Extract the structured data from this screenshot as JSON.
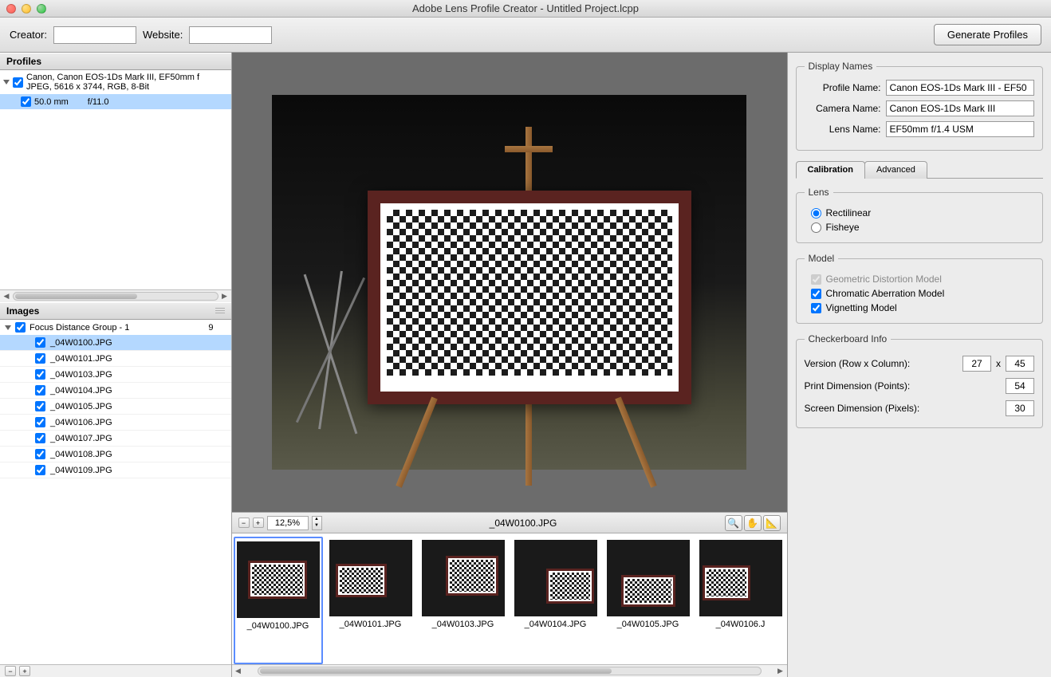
{
  "window": {
    "title": "Adobe Lens Profile Creator - Untitled Project.lcpp"
  },
  "toolbar": {
    "creator_label": "Creator:",
    "creator_value": "",
    "website_label": "Website:",
    "website_value": "",
    "generate_label": "Generate Profiles"
  },
  "profiles": {
    "header": "Profiles",
    "root": {
      "line1": "Canon, Canon EOS-1Ds Mark III, EF50mm f",
      "line2": "JPEG, 5616 x 3744, RGB, 8-Bit"
    },
    "child": {
      "focal": "50.0 mm",
      "aperture": "f/11.0"
    }
  },
  "images": {
    "header": "Images",
    "group": {
      "label": "Focus Distance Group - 1",
      "count": "9"
    },
    "list": [
      "_04W0100.JPG",
      "_04W0101.JPG",
      "_04W0103.JPG",
      "_04W0104.JPG",
      "_04W0105.JPG",
      "_04W0106.JPG",
      "_04W0107.JPG",
      "_04W0108.JPG",
      "_04W0109.JPG"
    ]
  },
  "preview": {
    "zoom": "12,5%",
    "filename": "_04W0100.JPG"
  },
  "thumbs": [
    "_04W0100.JPG",
    "_04W0101.JPG",
    "_04W0103.JPG",
    "_04W0104.JPG",
    "_04W0105.JPG",
    "_04W0106.J"
  ],
  "display_names": {
    "legend": "Display Names",
    "profile_label": "Profile Name:",
    "profile_value": "Canon EOS-1Ds Mark III - EF50",
    "camera_label": "Camera Name:",
    "camera_value": "Canon EOS-1Ds Mark III",
    "lens_label": "Lens Name:",
    "lens_value": "EF50mm f/1.4 USM"
  },
  "tabs": {
    "calibration": "Calibration",
    "advanced": "Advanced"
  },
  "lens_section": {
    "legend": "Lens",
    "rectilinear": "Rectilinear",
    "fisheye": "Fisheye"
  },
  "model_section": {
    "legend": "Model",
    "geometric": "Geometric Distortion Model",
    "chromatic": "Chromatic Aberration Model",
    "vignetting": "Vignetting Model"
  },
  "checker": {
    "legend": "Checkerboard Info",
    "version_label": "Version (Row x Column):",
    "rows": "27",
    "cols": "45",
    "print_label": "Print Dimension (Points):",
    "print_value": "54",
    "screen_label": "Screen Dimension (Pixels):",
    "screen_value": "30"
  }
}
